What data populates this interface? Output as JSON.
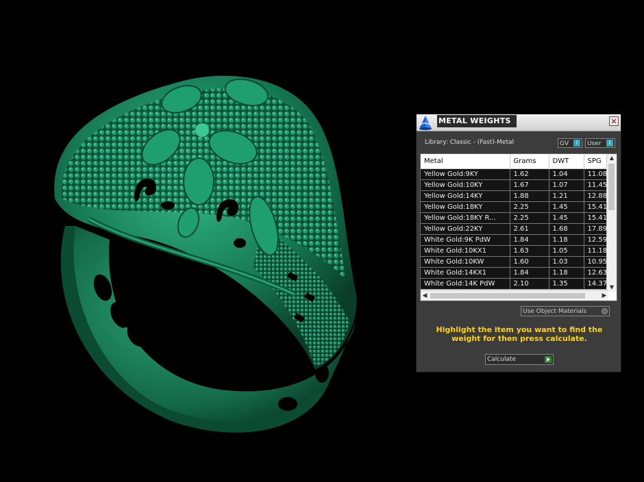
{
  "panel": {
    "title": "METAL WEIGHTS",
    "close_glyph": "✕",
    "library_label": "Library: Classic - (Fast)-Metal",
    "toggles": {
      "gv": "GV",
      "user": "User"
    },
    "table": {
      "columns": [
        "Metal",
        "Grams",
        "DWT",
        "SPG"
      ],
      "rows": [
        [
          "Yellow Gold:9KY",
          "1.62",
          "1.04",
          "11.08"
        ],
        [
          "Yellow Gold:10KY",
          "1.67",
          "1.07",
          "11.45"
        ],
        [
          "Yellow Gold:14KY",
          "1.88",
          "1.21",
          "12.88"
        ],
        [
          "Yellow Gold:18KY",
          "2.25",
          "1.45",
          "15.41"
        ],
        [
          "Yellow Gold:18KY R...",
          "2.25",
          "1.45",
          "15.41"
        ],
        [
          "Yellow Gold:22KY",
          "2.61",
          "1.68",
          "17.89"
        ],
        [
          "White Gold:9K PdW",
          "1.84",
          "1.18",
          "12.59"
        ],
        [
          "White Gold:10KX1",
          "1.63",
          "1.05",
          "11.18"
        ],
        [
          "White Gold:10KW",
          "1.60",
          "1.03",
          "10.95"
        ],
        [
          "White Gold:14KX1",
          "1.84",
          "1.18",
          "12.63"
        ],
        [
          "White Gold:14K PdW",
          "2.10",
          "1.35",
          "14.37"
        ]
      ]
    },
    "use_object_materials": "Use Object Materials",
    "instructions": "Highlight the item you want to find the weight for then press calculate.",
    "calculate_label": "Calculate"
  },
  "colors": {
    "viewport_bg": "#000000",
    "ring_green": "#1f8a66",
    "instruction_text": "#ffd21e",
    "toggle_accent": "#3aa3b8"
  },
  "icons": {
    "app": "cone-logo-icon",
    "close": "close-icon",
    "calculate": "play-arrow-icon"
  }
}
